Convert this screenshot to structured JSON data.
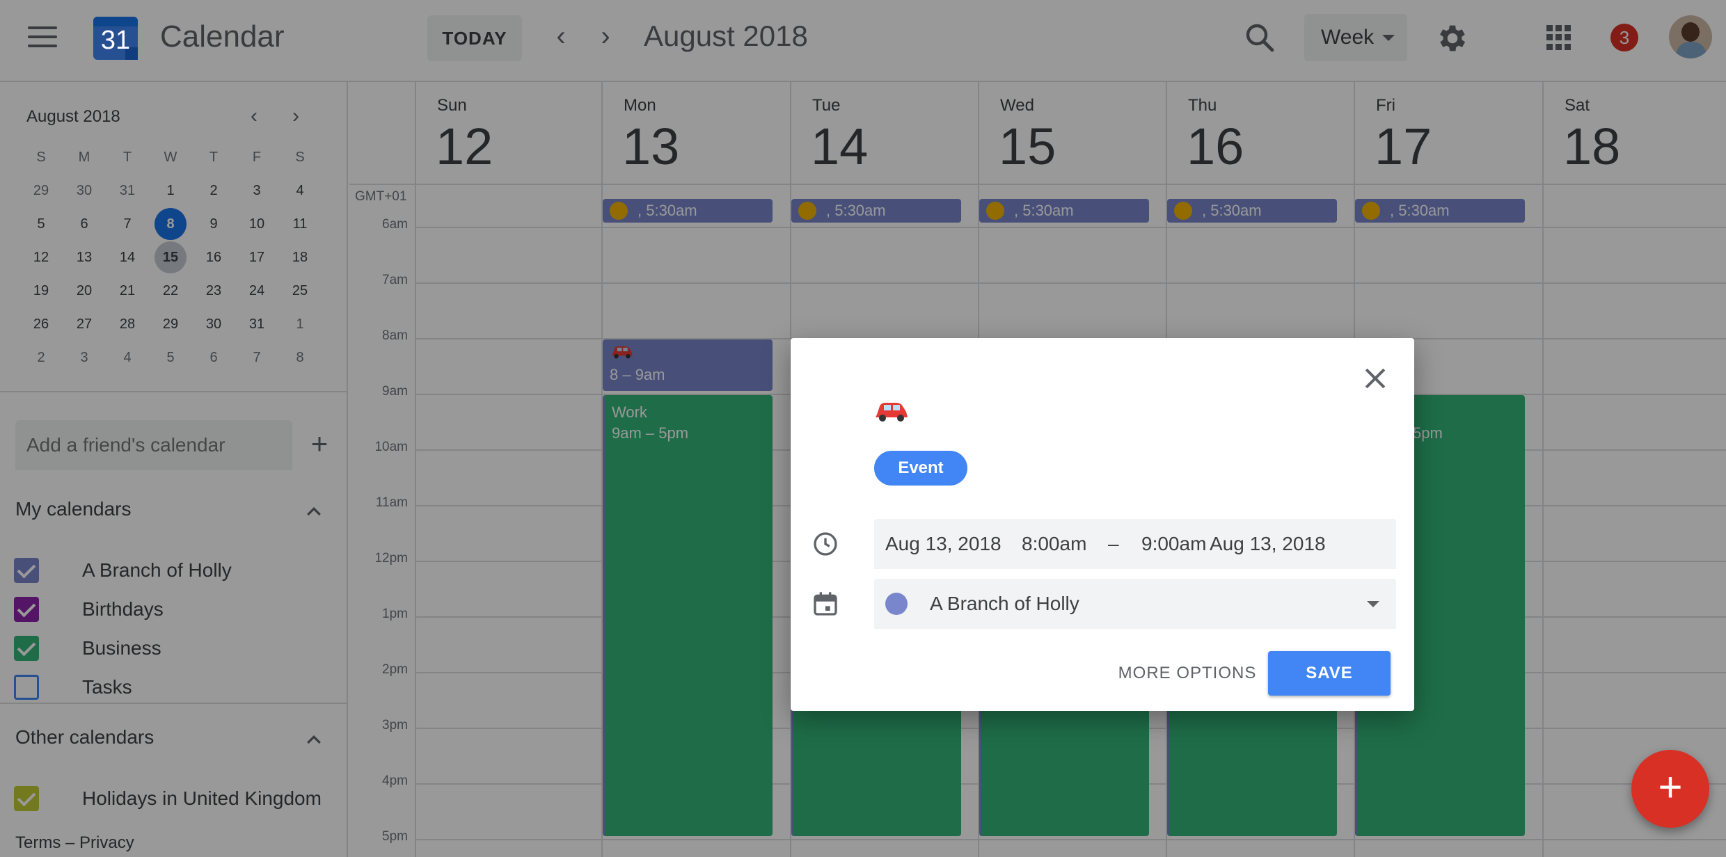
{
  "header": {
    "logo_day": "31",
    "app_name": "Calendar",
    "today_label": "TODAY",
    "prev_label": "‹",
    "next_label": "›",
    "title": "August 2018",
    "view_label": "Week",
    "notification_count": "3"
  },
  "mini_calendar": {
    "title": "August 2018",
    "prev_label": "‹",
    "next_label": "›",
    "weekdays": [
      "S",
      "M",
      "T",
      "W",
      "T",
      "F",
      "S"
    ],
    "weeks": [
      [
        "29",
        "30",
        "31",
        "1",
        "2",
        "3",
        "4"
      ],
      [
        "5",
        "6",
        "7",
        "8",
        "9",
        "10",
        "11"
      ],
      [
        "12",
        "13",
        "14",
        "15",
        "16",
        "17",
        "18"
      ],
      [
        "19",
        "20",
        "21",
        "22",
        "23",
        "24",
        "25"
      ],
      [
        "26",
        "27",
        "28",
        "29",
        "30",
        "31",
        "1"
      ],
      [
        "2",
        "3",
        "4",
        "5",
        "6",
        "7",
        "8"
      ]
    ],
    "today": "8",
    "selected": "15"
  },
  "sidebar": {
    "friend_placeholder": "Add a friend's calendar",
    "add_label": "+",
    "my_calendars_title": "My calendars",
    "my_calendars": [
      {
        "label": "A Branch of Holly",
        "color": "#7986cb",
        "checked": true
      },
      {
        "label": "Birthdays",
        "color": "#8e24aa",
        "checked": true
      },
      {
        "label": "Business",
        "color": "#33b679",
        "checked": true
      },
      {
        "label": "Tasks",
        "color": "#4285f4",
        "checked": false
      }
    ],
    "other_calendars_title": "Other calendars",
    "other_calendars": [
      {
        "label": "Holidays in United Kingdom",
        "color": "#c0ca33",
        "checked": true
      }
    ],
    "footer": "Terms – Privacy"
  },
  "week": {
    "timezone": "GMT+01",
    "days": [
      {
        "name": "Sun",
        "num": "12"
      },
      {
        "name": "Mon",
        "num": "13"
      },
      {
        "name": "Tue",
        "num": "14"
      },
      {
        "name": "Wed",
        "num": "15"
      },
      {
        "name": "Thu",
        "num": "16"
      },
      {
        "name": "Fri",
        "num": "17"
      },
      {
        "name": "Sat",
        "num": "18"
      }
    ],
    "times": [
      "6am",
      "7am",
      "8am",
      "9am",
      "10am",
      "11am",
      "12pm",
      "1pm",
      "2pm",
      "3pm",
      "4pm",
      "5pm"
    ],
    "allday_text": ", 5:30am",
    "events": {
      "drive_time": "8 – 9am",
      "work_title": "Work",
      "work_time": "9am – 5pm",
      "fri_work_time_partial": "5pm"
    }
  },
  "dialog": {
    "chip_label": "Event",
    "start_date": "Aug 13, 2018",
    "start_time": "8:00am",
    "dash": "–",
    "end_time": "9:00am",
    "end_date": "Aug 13, 2018",
    "calendar": "A Branch of Holly",
    "more_options": "MORE OPTIONS",
    "save": "SAVE"
  },
  "fab_label": "+",
  "colors": {
    "primary": "#4285f4",
    "event_purple": "#7986cb",
    "work_green": "#33b679",
    "fab_red": "#d93025"
  }
}
